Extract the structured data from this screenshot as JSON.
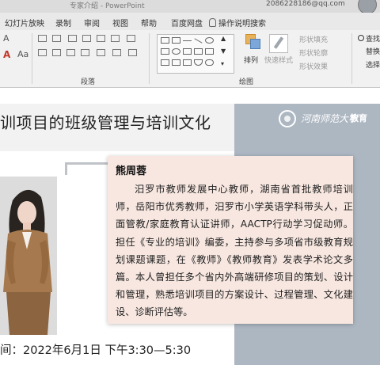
{
  "titlebar": {
    "title": "专家介绍  -  PowerPoint",
    "email": "2086228186@qq.com"
  },
  "menu": {
    "tabs": [
      "幻灯片放映",
      "录制",
      "审阅",
      "视图",
      "帮助",
      "百度网盘"
    ],
    "tell_me": "操作说明搜索"
  },
  "ribbon": {
    "groups": {
      "paragraph": "段落",
      "drawing": "绘图"
    },
    "arrange": "排列",
    "quick_styles": "快速样式",
    "shape_fill": "形状填充",
    "shape_outline": "形状轮廓",
    "shape_effects": "形状效果",
    "find": "查找",
    "replace": "替换",
    "select": "选择"
  },
  "slide": {
    "title": "训项目的班级管理与培训文化",
    "logo_text": "河南师范大学",
    "logo_suffix": "教育",
    "bio_name": "熊周蓉",
    "bio_text": "汨罗市教师发展中心教师，湖南省首批教师培训师，岳阳市优秀教师，汨罗市小学英语学科带头人，正面管教/家庭教育认证讲师，AACTP行动学习促动师。担任《专业的培训》编委，主持参与多项省市级教育规划课题课题，在《教师》《教师教育》发表学术论文多篇。本人曾担任多个省内外高端研修项目的策划、设计和管理，熟悉培训项目的方案设计、过程管理、文化建设、诊断评估等。",
    "time_text": "间：2022年6月1日 下午3:30—5:30"
  }
}
